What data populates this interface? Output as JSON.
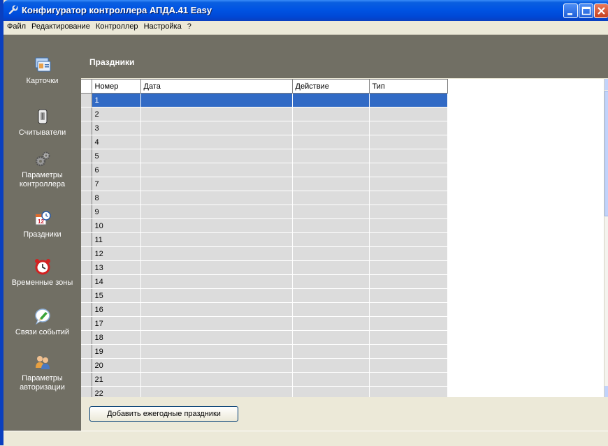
{
  "window": {
    "title": "Конфигуратор контроллера АПДА.41 Easy"
  },
  "menu": {
    "items": [
      "Файл",
      "Редактирование",
      "Контроллер",
      "Настройка",
      "?"
    ]
  },
  "sidebar": {
    "items": [
      {
        "label": "Карточки",
        "icon": "cards-icon"
      },
      {
        "label": "Считыватели",
        "icon": "reader-icon"
      },
      {
        "label": "Параметры контроллера",
        "icon": "gears-icon"
      },
      {
        "label": "Праздники",
        "icon": "calendar-icon"
      },
      {
        "label": "Временные зоны",
        "icon": "alarm-clock-icon"
      },
      {
        "label": "Связи событий",
        "icon": "event-link-icon"
      },
      {
        "label": "Параметры авторизации",
        "icon": "users-icon"
      }
    ]
  },
  "section": {
    "title": "Праздники"
  },
  "grid": {
    "columns": [
      "Номер",
      "Дата",
      "Действие",
      "Тип"
    ],
    "rows": [
      "1",
      "2",
      "3",
      "4",
      "5",
      "6",
      "7",
      "8",
      "9",
      "10",
      "11",
      "12",
      "13",
      "14",
      "15",
      "16",
      "17",
      "18",
      "19",
      "20",
      "21",
      "22"
    ],
    "selected_row": "1",
    "selection_color": "#316ac5"
  },
  "actions": {
    "add_yearly_holidays": "Добавить ежегодные праздники"
  },
  "colors": {
    "titlebar": "#0054e3",
    "sidebar": "#716f64",
    "row_background": "#dcdcdc"
  }
}
